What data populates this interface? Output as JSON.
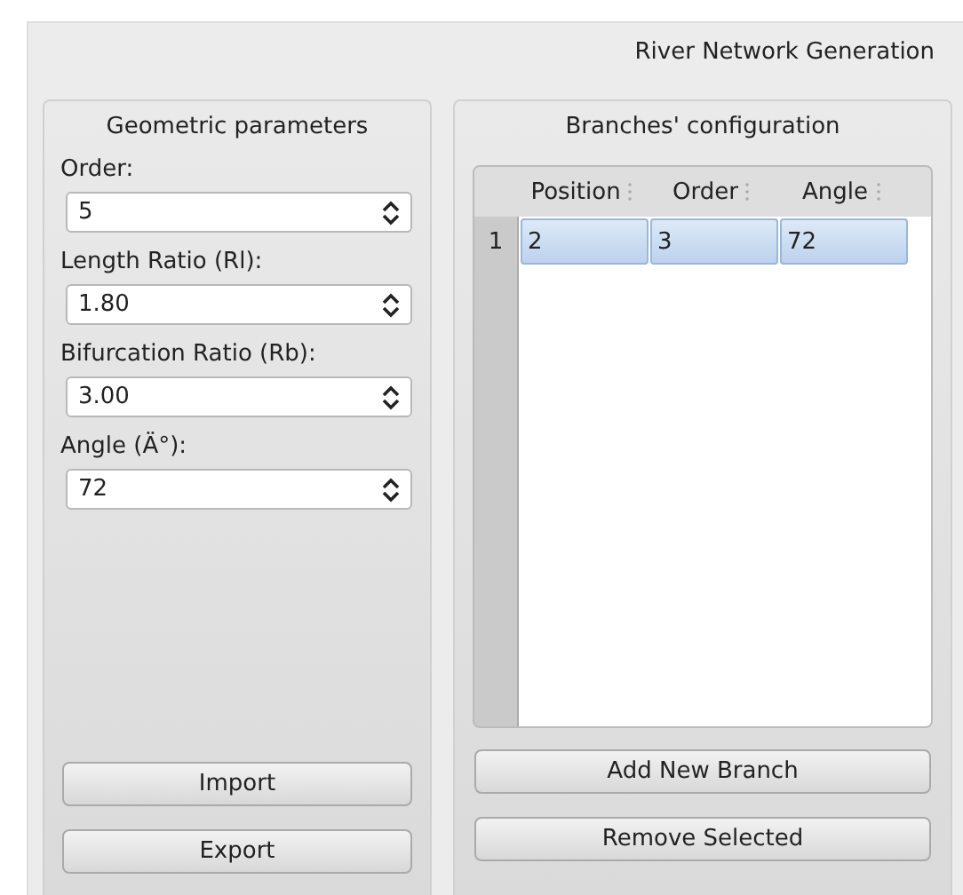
{
  "window": {
    "title": "River Network Generation"
  },
  "geometric_parameters": {
    "title": "Geometric parameters",
    "fields": [
      {
        "label": "Order:",
        "value": "5"
      },
      {
        "label": "Length Ratio (Rl):",
        "value": "1.80"
      },
      {
        "label": "Bifurcation Ratio (Rb):",
        "value": "3.00"
      },
      {
        "label": "Angle (Ä°):",
        "value": "72"
      }
    ],
    "buttons": [
      "Import",
      "Export"
    ]
  },
  "branches": {
    "title": "Branches' configuration",
    "table": {
      "columns": [
        "Position",
        "Order",
        "Angle"
      ],
      "rows": [
        {
          "header": "1",
          "selected": true,
          "cells": [
            "2",
            "3",
            "72"
          ]
        }
      ]
    },
    "buttons": [
      "Add New Branch",
      "Remove Selected"
    ]
  }
}
